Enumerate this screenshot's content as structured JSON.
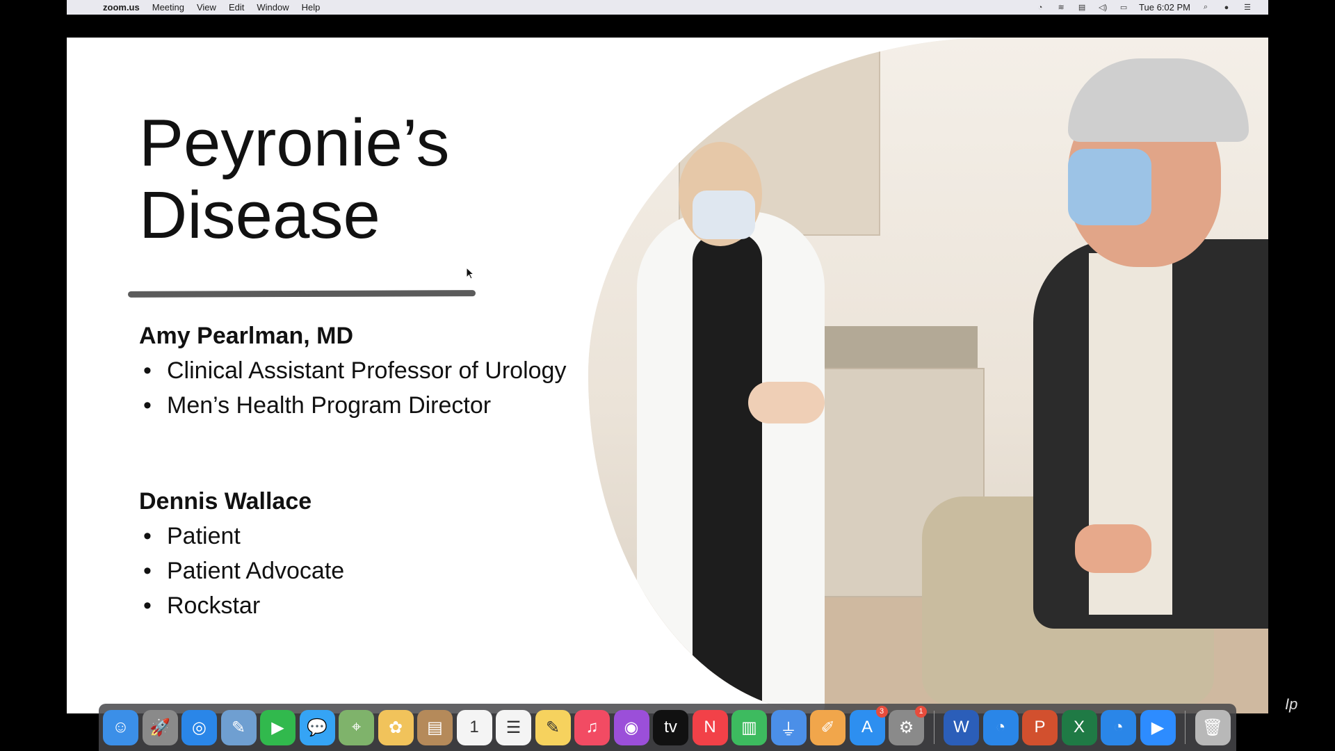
{
  "menubar": {
    "app_name": "zoom.us",
    "menus": [
      "Meeting",
      "View",
      "Edit",
      "Window",
      "Help"
    ],
    "clock": "Tue 6:02 PM"
  },
  "slide": {
    "title_line1": "Peyronie’s",
    "title_line2": "Disease",
    "person1": {
      "name": "Amy Pearlman, MD",
      "roles": [
        "Clinical Assistant Professor of Urology",
        "Men’s Health Program Director"
      ]
    },
    "person2": {
      "name": "Dennis Wallace",
      "roles": [
        "Patient",
        "Patient Advocate",
        "Rockstar"
      ]
    }
  },
  "dock": {
    "apps": [
      {
        "name": "finder-icon",
        "glyph": "☺",
        "color": "#3b8fe8"
      },
      {
        "name": "launchpad-icon",
        "glyph": "🚀",
        "color": "#8a8a8a"
      },
      {
        "name": "safari-icon",
        "glyph": "◎",
        "color": "#2a86e8"
      },
      {
        "name": "preview-icon",
        "glyph": "✎",
        "color": "#6f9fd1"
      },
      {
        "name": "facetime-icon",
        "glyph": "▶",
        "color": "#31b94d"
      },
      {
        "name": "messages-icon",
        "glyph": "💬",
        "color": "#35a4f5"
      },
      {
        "name": "maps-icon",
        "glyph": "⌖",
        "color": "#7fb36b"
      },
      {
        "name": "photos-icon",
        "glyph": "✿",
        "color": "#f1c35b"
      },
      {
        "name": "contacts-icon",
        "glyph": "▤",
        "color": "#b58a5a"
      },
      {
        "name": "calendar-icon",
        "glyph": "1",
        "color": "#f4f4f4"
      },
      {
        "name": "reminders-icon",
        "glyph": "☰",
        "color": "#f4f4f4"
      },
      {
        "name": "notes-icon",
        "glyph": "✎",
        "color": "#f6d25e"
      },
      {
        "name": "music-icon",
        "glyph": "♫",
        "color": "#f24b63"
      },
      {
        "name": "podcasts-icon",
        "glyph": "◉",
        "color": "#9b4fd9"
      },
      {
        "name": "appletv-icon",
        "glyph": "tv",
        "color": "#111111"
      },
      {
        "name": "news-icon",
        "glyph": "N",
        "color": "#f24148"
      },
      {
        "name": "numbers-icon",
        "glyph": "▥",
        "color": "#3dbb5f"
      },
      {
        "name": "keynote-icon",
        "glyph": "⏚",
        "color": "#4b8fe8"
      },
      {
        "name": "pages-icon",
        "glyph": "✐",
        "color": "#f1a64b"
      },
      {
        "name": "appstore-icon",
        "glyph": "A",
        "color": "#2d8ff0",
        "badge": "3"
      },
      {
        "name": "system-preferences-icon",
        "glyph": "⚙",
        "color": "#8a8a8a",
        "badge": "1"
      }
    ],
    "apps_right": [
      {
        "name": "word-icon",
        "glyph": "W",
        "color": "#2b5eb9"
      },
      {
        "name": "activity-app-icon",
        "glyph": "◔",
        "color": "#2a86e8"
      },
      {
        "name": "powerpoint-icon",
        "glyph": "P",
        "color": "#d2502e"
      },
      {
        "name": "excel-icon",
        "glyph": "X",
        "color": "#1f7a45"
      },
      {
        "name": "activity-app-2-icon",
        "glyph": "◔",
        "color": "#2a86e8"
      },
      {
        "name": "zoom-icon",
        "glyph": "▶",
        "color": "#2d8cff"
      }
    ],
    "trash": {
      "name": "trash-icon",
      "glyph": "🗑",
      "color": "#b8b8b8"
    }
  }
}
